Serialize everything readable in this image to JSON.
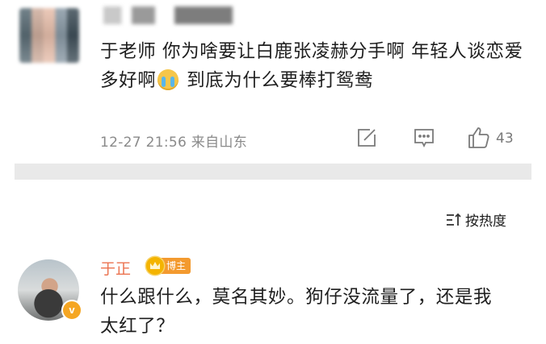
{
  "comment": {
    "text_part1": "于老师 你为啥要让白鹿张凌赫分手啊 年轻人谈恋爱多好啊",
    "emoji": "crying-emoji",
    "text_part2": " 到底为什么要棒打鸳鸯",
    "meta": "12-27 21:56 来自山东",
    "like_count": "43"
  },
  "sort": {
    "label": "按热度"
  },
  "reply": {
    "username": "于正",
    "badge": "博主",
    "verified_mark": "v",
    "text": "什么跟什么，莫名其妙。狗仔没流量了，还是我太红了？"
  },
  "colors": {
    "username_orange": "#eb7350",
    "badge_orange": "#f39a2f",
    "meta_gray": "#8a8a8a",
    "divider_gray": "#e9e9e9"
  }
}
